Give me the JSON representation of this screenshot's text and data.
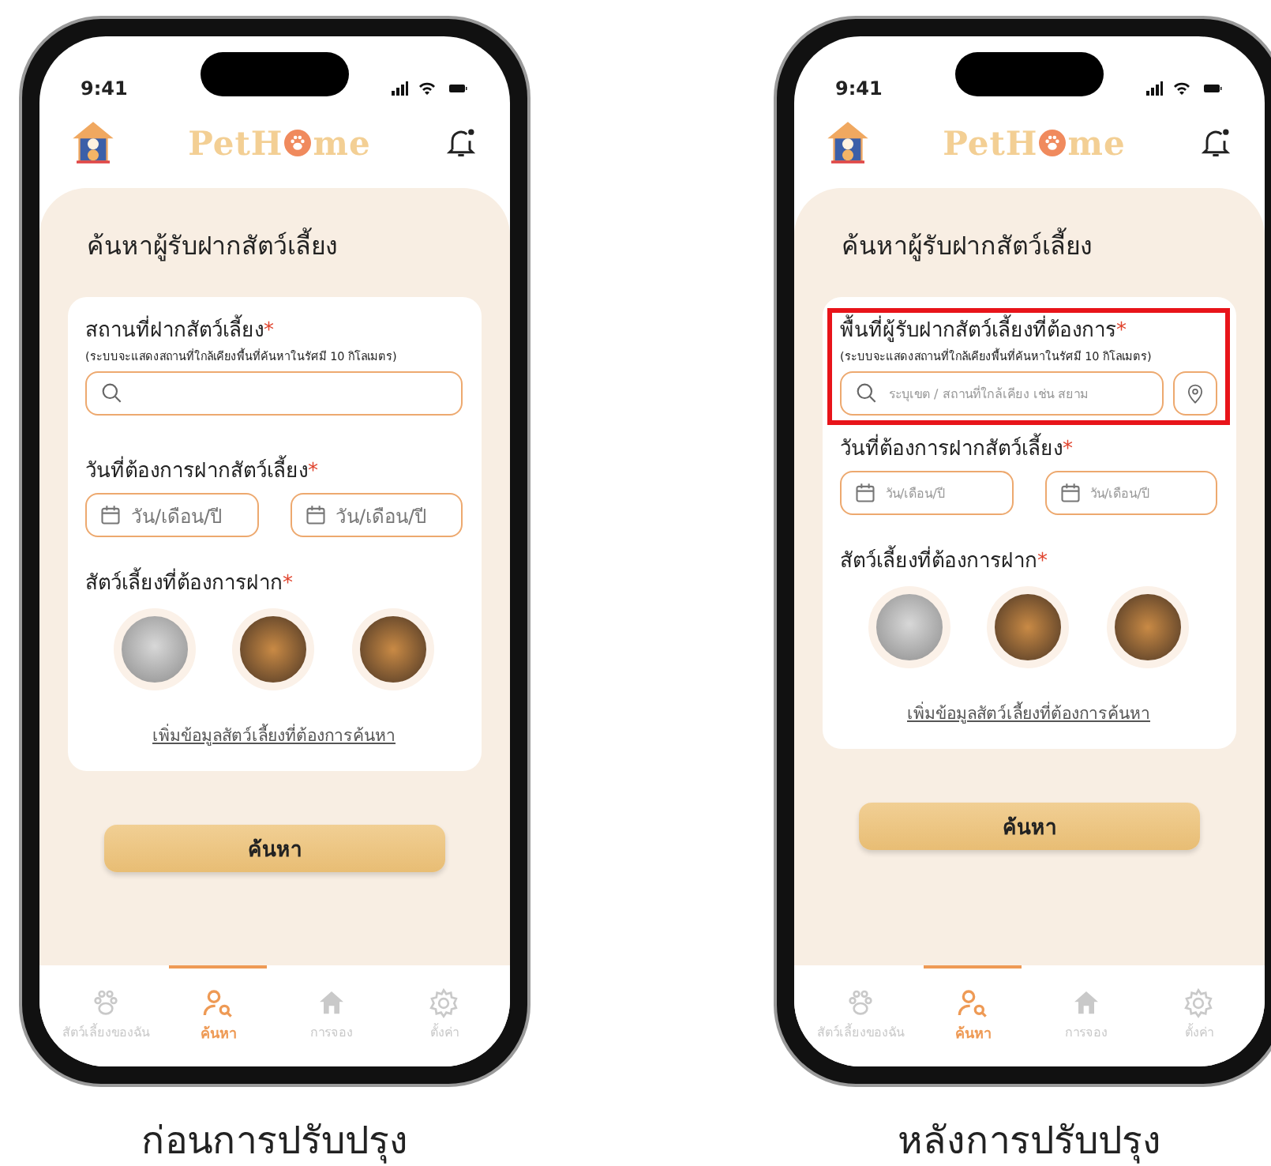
{
  "phones": [
    {
      "status_time": "9:41",
      "logo_start": "PetH",
      "logo_end": "me",
      "title": "ค้นหาผู้รับฝากสัตว์เลี้ยง",
      "location": {
        "highlighted": false,
        "label": "สถานที่ฝากสัตว์เลี้ยง",
        "required": "*",
        "hint": "(ระบบจะแสดงสถานที่ใกล้เคียงพื้นที่ค้นหาในรัศมี 10 กิโลเมตร)",
        "has_pin_button": false
      },
      "date": {
        "label": "วันที่ต้องการฝากสัตว์เลี้ยง",
        "required": "*",
        "fields": [
          {
            "placeholder": "วัน/เดือน/ปี"
          },
          {
            "placeholder": "วัน/เดือน/ปี"
          }
        ]
      },
      "pets": {
        "label": "สัตว์เลี้ยงที่ต้องการฝาก",
        "required": "*",
        "photos": [
          {
            "kind": "cat"
          },
          {
            "kind": "dog"
          },
          {
            "kind": "dog"
          }
        ],
        "link": "เพิ่มข้อมูลสัตว์เลี้ยงที่ต้องการค้นหา"
      },
      "search_button": "ค้นหา",
      "tabs": [
        {
          "kind": "paw",
          "label": "สัตว์เลี้ยงของฉัน",
          "selected": false
        },
        {
          "kind": "search",
          "label": "ค้นหา",
          "selected": true
        },
        {
          "kind": "home",
          "label": "การจอง",
          "selected": false
        },
        {
          "kind": "gear",
          "label": "ตั้งค่า",
          "selected": false
        }
      ],
      "caption": "ก่อนการปรับปรุง"
    },
    {
      "status_time": "9:41",
      "logo_start": "PetH",
      "logo_end": "me",
      "title": "ค้นหาผู้รับฝากสัตว์เลี้ยง",
      "location": {
        "highlighted": true,
        "label": "พื้นที่ผู้รับฝากสัตว์เลี้ยงที่ต้องการ",
        "required": "*",
        "hint": "(ระบบจะแสดงสถานที่ใกล้เคียงพื้นที่ค้นหาในรัศมี 10 กิโลเมตร)",
        "placeholder": "ระบุเขต / สถานที่ใกล้เคียง เช่น สยาม",
        "has_pin_button": true
      },
      "date": {
        "label": "วันที่ต้องการฝากสัตว์เลี้ยง",
        "required": "*",
        "fields": [
          {
            "placeholder": "วัน/เดือน/ปี"
          },
          {
            "placeholder": "วัน/เดือน/ปี"
          }
        ]
      },
      "pets": {
        "label": "สัตว์เลี้ยงที่ต้องการฝาก",
        "required": "*",
        "photos": [
          {
            "kind": "cat"
          },
          {
            "kind": "dog"
          },
          {
            "kind": "dog"
          }
        ],
        "link": "เพิ่มข้อมูลสัตว์เลี้ยงที่ต้องการค้นหา"
      },
      "search_button": "ค้นหา",
      "tabs": [
        {
          "kind": "paw",
          "label": "สัตว์เลี้ยงของฉัน",
          "selected": false
        },
        {
          "kind": "search",
          "label": "ค้นหา",
          "selected": true
        },
        {
          "kind": "home",
          "label": "การจอง",
          "selected": false
        },
        {
          "kind": "gear",
          "label": "ตั้งค่า",
          "selected": false
        }
      ],
      "caption": "หลังการปรับปรุง"
    }
  ]
}
